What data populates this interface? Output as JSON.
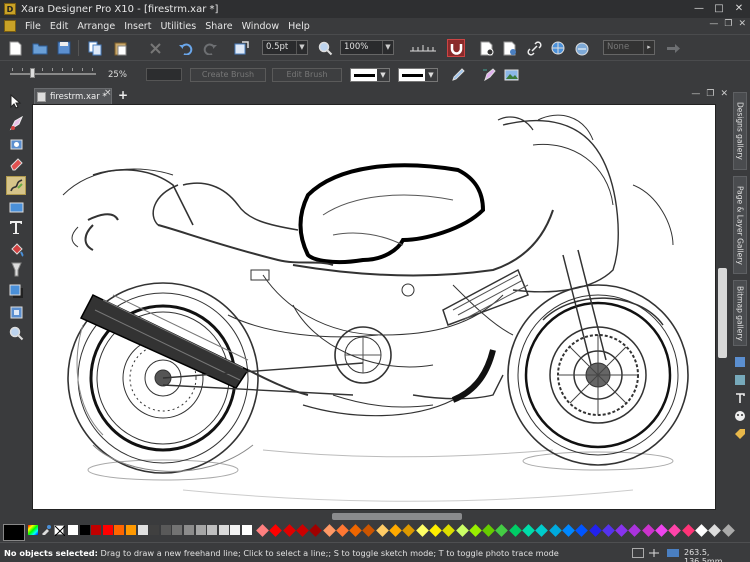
{
  "window": {
    "title": "Xara Designer Pro X10 - [firestrm.xar *]",
    "app_icon_letter": "D"
  },
  "menu": {
    "items": [
      "File",
      "Edit",
      "Arrange",
      "Insert",
      "Utilities",
      "Share",
      "Window",
      "Help"
    ]
  },
  "toolbar": {
    "line_width": "0.5pt",
    "zoom": "100%",
    "opacity_field": "None"
  },
  "infobar": {
    "pressure_pct": "25%",
    "create_brush_label": "Create Brush",
    "edit_brush_label": "Edit Brush"
  },
  "document_tab": {
    "label": "firestrm.xar *",
    "close": "×",
    "add": "+"
  },
  "right_panel": {
    "designs_gallery": "Designs gallery",
    "page_layer_gallery": "Page & Layer Gallery",
    "bitmap_gallery": "Bitmap gallery"
  },
  "palette": {
    "colors": [
      "#ffffff",
      "#000000",
      "#c00000",
      "#ff0000",
      "#ff6600",
      "#ff9900",
      "#e0e0e0",
      "#404040",
      "#595959",
      "#737373",
      "#8c8c8c",
      "#a6a6a6",
      "#bfbfbf",
      "#d9d9d9",
      "#f2f2f2",
      "#ffffff"
    ],
    "diamond_colors": [
      "#ff8080",
      "#ff0000",
      "#e00000",
      "#cc0000",
      "#a00000",
      "#ff9966",
      "#ff7733",
      "#ee6600",
      "#cc5500",
      "#ffcc66",
      "#ffaa00",
      "#dd9900",
      "#ffff66",
      "#ffee00",
      "#dddd00",
      "#ccff66",
      "#99ee00",
      "#66cc00",
      "#44cc44",
      "#00cc66",
      "#00ddaa",
      "#00cccc",
      "#00aadd",
      "#0088ff",
      "#0055ff",
      "#2222ee",
      "#5533ee",
      "#8833ee",
      "#aa33dd",
      "#cc33cc",
      "#ee44ee",
      "#ff44aa",
      "#ff3377",
      "#ffffff",
      "#dddddd",
      "#aaaaaa"
    ]
  },
  "status": {
    "bold": "No objects selected:",
    "text": " Drag to draw a new freehand line; Click to select a line;; S to toggle sketch mode; T to toggle photo trace mode",
    "coords": "263.5, 136.5mm"
  }
}
